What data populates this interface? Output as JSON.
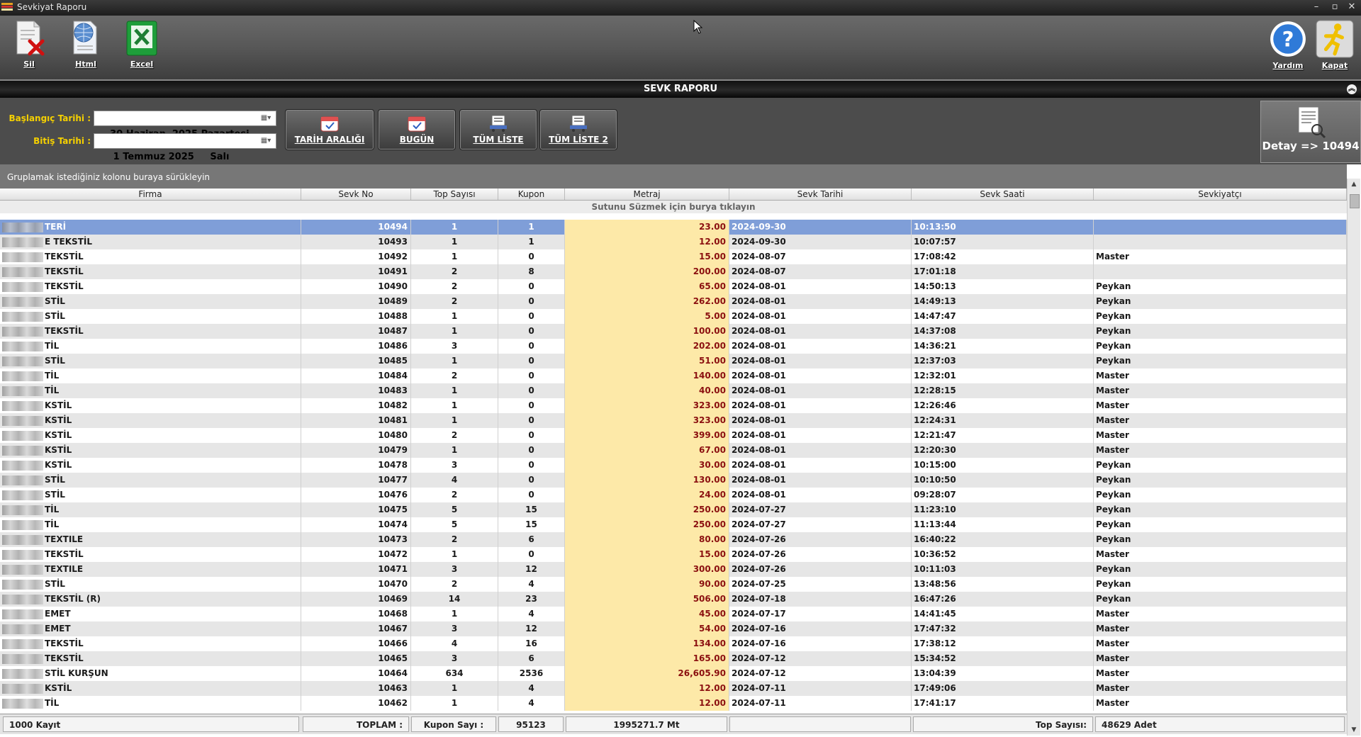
{
  "window": {
    "title": "Sevkiyat Raporu",
    "controls": [
      "–",
      "▫",
      "✕"
    ]
  },
  "toolbar": {
    "left": [
      {
        "label": "Sil",
        "icon": "delete-document-icon"
      },
      {
        "label": "Html",
        "icon": "html-globe-icon"
      },
      {
        "label": "Excel",
        "icon": "excel-icon"
      }
    ],
    "right": [
      {
        "label": "Yardım",
        "icon": "help-icon"
      },
      {
        "label": "Kapat",
        "icon": "exit-runner-icon"
      }
    ]
  },
  "section_title": "SEVK RAPORU",
  "filters": {
    "start_label": "Başlangıç Tarihi :",
    "start_value": "30 Haziran  2025 Pazartesi",
    "end_label": "Bitiş Tarihi :",
    "end_value": " 1 Temmuz 2025     Salı",
    "buttons": [
      "TARİH ARALIĞI",
      "BUGÜN",
      "TÜM LİSTE",
      "TÜM LİSTE 2"
    ]
  },
  "detail_button": "Detay => 10494",
  "grid": {
    "group_hint": "Gruplamak istediğiniz kolonu buraya sürükleyin",
    "filter_hint": "Sutunu Süzmek için burya tıklayın",
    "columns": [
      "Firma",
      "Sevk No",
      "Top Sayısı",
      "Kupon",
      "Metraj",
      "Sevk Tarihi",
      "Sevk Saati",
      "Sevkiyatçı"
    ],
    "rows": [
      [
        "TERİ",
        "10494",
        "1",
        "1",
        "23.00",
        "2024-09-30",
        "10:13:50",
        ""
      ],
      [
        "E TEKSTİL",
        "10493",
        "1",
        "1",
        "12.00",
        "2024-09-30",
        "10:07:57",
        ""
      ],
      [
        "TEKSTİL",
        "10492",
        "1",
        "0",
        "15.00",
        "2024-08-07",
        "17:08:42",
        "Master"
      ],
      [
        "TEKSTİL",
        "10491",
        "2",
        "8",
        "200.00",
        "2024-08-07",
        "17:01:18",
        ""
      ],
      [
        "TEKSTİL",
        "10490",
        "2",
        "0",
        "65.00",
        "2024-08-01",
        "14:50:13",
        "Peykan"
      ],
      [
        "STİL",
        "10489",
        "2",
        "0",
        "262.00",
        "2024-08-01",
        "14:49:13",
        "Peykan"
      ],
      [
        "STİL",
        "10488",
        "1",
        "0",
        "5.00",
        "2024-08-01",
        "14:47:47",
        "Peykan"
      ],
      [
        "TEKSTİL",
        "10487",
        "1",
        "0",
        "100.00",
        "2024-08-01",
        "14:37:08",
        "Peykan"
      ],
      [
        "TİL",
        "10486",
        "3",
        "0",
        "202.00",
        "2024-08-01",
        "14:36:21",
        "Peykan"
      ],
      [
        "STİL",
        "10485",
        "1",
        "0",
        "51.00",
        "2024-08-01",
        "12:37:03",
        "Peykan"
      ],
      [
        "TİL",
        "10484",
        "2",
        "0",
        "140.00",
        "2024-08-01",
        "12:32:01",
        "Master"
      ],
      [
        "TİL",
        "10483",
        "1",
        "0",
        "40.00",
        "2024-08-01",
        "12:28:15",
        "Master"
      ],
      [
        "KSTİL",
        "10482",
        "1",
        "0",
        "323.00",
        "2024-08-01",
        "12:26:46",
        "Master"
      ],
      [
        "KSTİL",
        "10481",
        "1",
        "0",
        "323.00",
        "2024-08-01",
        "12:24:31",
        "Master"
      ],
      [
        "KSTİL",
        "10480",
        "2",
        "0",
        "399.00",
        "2024-08-01",
        "12:21:47",
        "Master"
      ],
      [
        "KSTİL",
        "10479",
        "1",
        "0",
        "67.00",
        "2024-08-01",
        "12:20:30",
        "Master"
      ],
      [
        "KSTİL",
        "10478",
        "3",
        "0",
        "30.00",
        "2024-08-01",
        "10:15:00",
        "Peykan"
      ],
      [
        "STİL",
        "10477",
        "4",
        "0",
        "130.00",
        "2024-08-01",
        "10:10:50",
        "Peykan"
      ],
      [
        "STİL",
        "10476",
        "2",
        "0",
        "24.00",
        "2024-08-01",
        "09:28:07",
        "Peykan"
      ],
      [
        "TİL",
        "10475",
        "5",
        "15",
        "250.00",
        "2024-07-27",
        "11:23:10",
        "Peykan"
      ],
      [
        "TİL",
        "10474",
        "5",
        "15",
        "250.00",
        "2024-07-27",
        "11:13:44",
        "Peykan"
      ],
      [
        "TEXTILE",
        "10473",
        "2",
        "6",
        "80.00",
        "2024-07-26",
        "16:40:22",
        "Peykan"
      ],
      [
        "TEKSTİL",
        "10472",
        "1",
        "0",
        "15.00",
        "2024-07-26",
        "10:36:52",
        "Master"
      ],
      [
        "TEXTILE",
        "10471",
        "3",
        "12",
        "300.00",
        "2024-07-26",
        "10:11:03",
        "Peykan"
      ],
      [
        "STİL",
        "10470",
        "2",
        "4",
        "90.00",
        "2024-07-25",
        "13:48:56",
        "Peykan"
      ],
      [
        "TEKSTİL (R)",
        "10469",
        "14",
        "23",
        "506.00",
        "2024-07-18",
        "16:47:26",
        "Peykan"
      ],
      [
        "EMET",
        "10468",
        "1",
        "4",
        "45.00",
        "2024-07-17",
        "14:41:45",
        "Master"
      ],
      [
        "EMET",
        "10467",
        "3",
        "12",
        "54.00",
        "2024-07-16",
        "17:47:32",
        "Master"
      ],
      [
        "TEKSTİL",
        "10466",
        "4",
        "16",
        "134.00",
        "2024-07-16",
        "17:38:12",
        "Master"
      ],
      [
        "TEKSTİL",
        "10465",
        "3",
        "6",
        "165.00",
        "2024-07-12",
        "15:34:52",
        "Master"
      ],
      [
        "STİL KURŞUN",
        "10464",
        "634",
        "2536",
        "26,605.90",
        "2024-07-12",
        "13:04:39",
        "Master"
      ],
      [
        "KSTİL",
        "10463",
        "1",
        "4",
        "12.00",
        "2024-07-11",
        "17:49:06",
        "Master"
      ],
      [
        "TİL",
        "10462",
        "1",
        "4",
        "12.00",
        "2024-07-11",
        "17:41:17",
        "Master"
      ]
    ],
    "selected_row": 0
  },
  "footer": {
    "record_count": "1000 Kayıt",
    "total_label": "TOPLAM :",
    "kupon_label": "Kupon Sayı :",
    "kupon_value": "95123",
    "metraj_total": "1995271.7 Mt",
    "top_label": "Top Sayısı:",
    "top_value": "48629 Adet"
  }
}
